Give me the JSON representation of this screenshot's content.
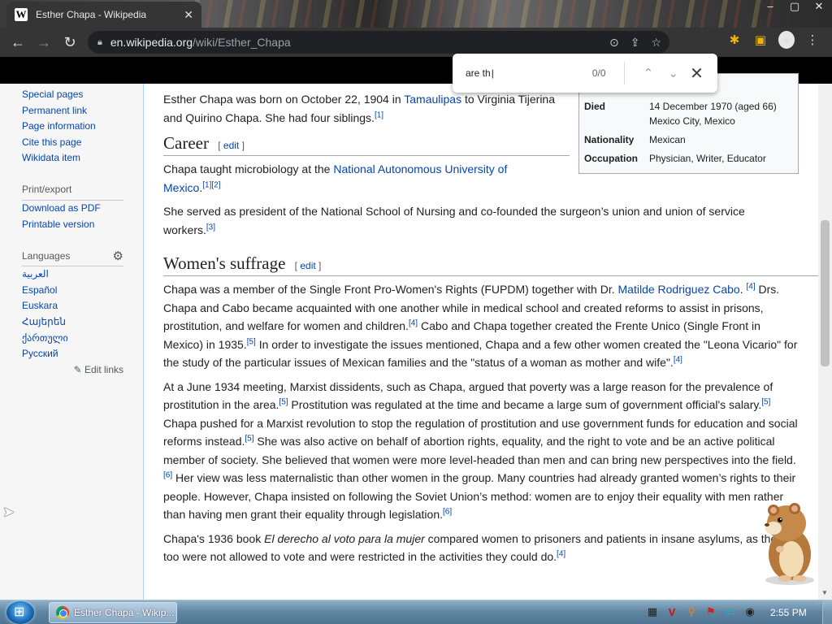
{
  "browser": {
    "tab": {
      "favicon": "W",
      "title": "Esther Chapa - Wikipedia",
      "close": "✕"
    },
    "window_controls": {
      "minimize": "–",
      "maximize": "▢",
      "close": "✕"
    },
    "nav": {
      "back": "←",
      "forward": "→",
      "reload": "↻"
    },
    "url": {
      "domain": "en.wikipedia.org",
      "path": "/wiki/Esther_Chapa"
    },
    "omnibox_icons": [
      "zoom-icon",
      "share-icon",
      "star-icon"
    ],
    "toolbar_icons": [
      "extensions-icon",
      "sidepanel-icon",
      "profile-icon",
      "menu-icon"
    ]
  },
  "find_bar": {
    "query": "are th",
    "count": "0/0",
    "prev": "⌃",
    "next": "⌄",
    "close": "✕"
  },
  "sidebar": {
    "tools_links": [
      "Special pages",
      "Permanent link",
      "Page information",
      "Cite this page",
      "Wikidata item"
    ],
    "print_heading": "Print/export",
    "print_links": [
      "Download as PDF",
      "Printable version"
    ],
    "languages_heading": "Languages",
    "language_links": [
      "العربية",
      "Español",
      "Euskara",
      "Հայերեն",
      "ქართული",
      "Русский"
    ],
    "edit_links": "Edit links"
  },
  "infobox": {
    "partial_top": "xico",
    "rows": [
      {
        "label": "Died",
        "value": "14 December 1970 (aged 66) Mexico City, Mexico"
      },
      {
        "label": "Nationality",
        "value": "Mexican"
      },
      {
        "label": "Occupation",
        "value": "Physician, Writer, Educator"
      }
    ]
  },
  "article": {
    "p_intro_a": "Esther Chapa was born on October 22, 1904 in ",
    "p_intro_link": "Tamaulipas",
    "p_intro_b": " to Virginia Tijerina and Quirino Chapa. She had four siblings.",
    "ref1": "[1]",
    "career_heading": "Career",
    "edit_label": "edit",
    "career_p1_a": "Chapa taught microbiology at the ",
    "career_p1_link": "National Autonomous University of Mexico",
    "career_p1_refs": "[1][2]",
    "career_p2": "She served as president of the National School of Nursing and co-founded the surgeon’s union and union of service workers.",
    "ref3": "[3]",
    "suffrage_heading": "Women's suffrage",
    "s1_a": "Chapa was a member of the Single Front Pro-Women's Rights (FUPDM) together with Dr. ",
    "s1_link": "Matilde Rodriguez Cabo",
    "s1_b": ". ",
    "ref4": "[4]",
    "s1_c": " Drs. Chapa and Cabo became acquainted with one another while in medical school and created reforms to assist in prisons, prostitution, and welfare for women and children.",
    "s1_d": " Cabo and Chapa together created the Frente Unico (Single Front in Mexico) in 1935.",
    "ref5": "[5]",
    "s1_e": " In order to investigate the issues mentioned, Chapa and a few other women created the \"Leona Vicario\" for the study of the particular issues of Mexican families and the \"status of a woman as mother and wife\".",
    "s2_a": "At a June 1934 meeting, Marxist dissidents, such as Chapa, argued that poverty was a large reason for the prevalence of prostitution in the area.",
    "s2_b": " Prostitution was regulated at the time and became a large sum of government official's salary.",
    "s2_c": " Chapa pushed for a Marxist revolution to stop the regulation of prostitution and use government funds for education and social reforms instead.",
    "s2_d": " She was also active on behalf of abortion rights, equality, and the right to vote and be an active political member of society. She believed that women were more level-headed than men and can bring new perspectives into the field.",
    "ref6": "[6]",
    "s2_e": " Her view was less maternalistic than other women in the group. Many countries had already granted women’s rights to their people. However, Chapa insisted on following the Soviet Union’s method: women are to enjoy their equality with men rather than having men grant their equality through legislation.",
    "s3_a": "Chapa's 1936 book ",
    "s3_book": "El derecho al voto para la mujer",
    "s3_b": " compared women to prisoners and patients in insane asylums, as they too were not allowed to vote and were restricted in the activities they could do."
  },
  "taskbar": {
    "task_label": "Esther Chapa - Wikip...",
    "clock": "2:55 PM"
  }
}
